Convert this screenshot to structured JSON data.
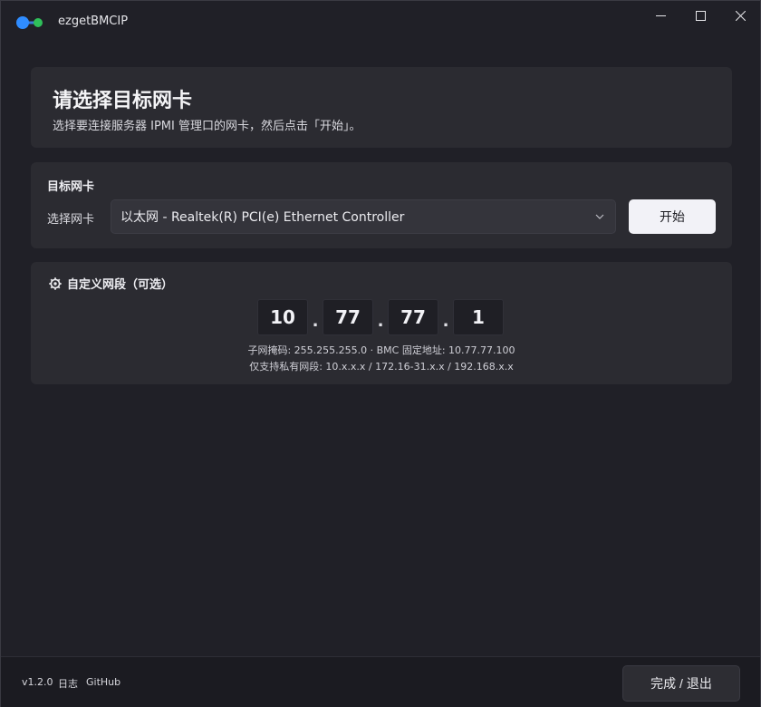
{
  "window": {
    "title": "ezgetBMCIP",
    "accent": "#2f8cff",
    "accent2": "#2fbf5a"
  },
  "header": {
    "title": "请选择目标网卡",
    "subtitle": "选择要连接服务器 IPMI 管理口的网卡，然后点击「开始」。"
  },
  "nic": {
    "section_title": "目标网卡",
    "field_label": "选择网卡",
    "selected": "以太网 - Realtek(R) PCI(e) Ethernet Controller",
    "start_label": "开始"
  },
  "network": {
    "title": "自定义网段（可选）",
    "octets": [
      "10",
      "77",
      "77",
      "1"
    ],
    "info_line1": "子网掩码: 255.255.255.0  ·  BMC 固定地址: 10.77.77.100",
    "info_line2": "仅支持私有网段: 10.x.x.x / 172.16-31.x.x / 192.168.x.x"
  },
  "footer": {
    "version": "v1.2.0",
    "log_label": "日志",
    "github_label": "GitHub",
    "exit_label": "完成 / 退出"
  }
}
